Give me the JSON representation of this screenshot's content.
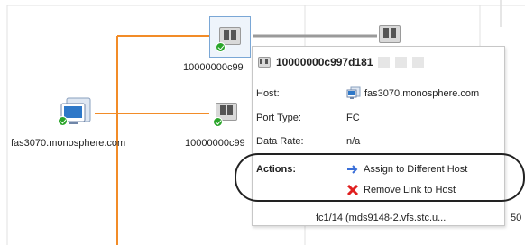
{
  "canvas": {
    "nodes": {
      "host_main": {
        "label": "fas3070.monosphere.com"
      },
      "port_top": {
        "label": "10000000c99"
      },
      "port_mid": {
        "label": "10000000c99"
      }
    },
    "colors": {
      "link_orange": "#f28c28",
      "link_gray": "#9a9a9a",
      "status_green": "#2aa52a"
    }
  },
  "popup": {
    "title": "10000000c997d181",
    "rows": [
      {
        "label": "Host:",
        "value": "fas3070.monosphere.com"
      },
      {
        "label": "Port Type:",
        "value": "FC"
      },
      {
        "label": "Data Rate:",
        "value": "n/a"
      }
    ],
    "actions": {
      "label": "Actions:",
      "assign": "Assign to Different Host",
      "remove": "Remove Link to Host"
    }
  },
  "bottom": {
    "switch_port": "fc1/14 (mds9148-2.vfs.stc.u...",
    "right_fragment": "50"
  }
}
